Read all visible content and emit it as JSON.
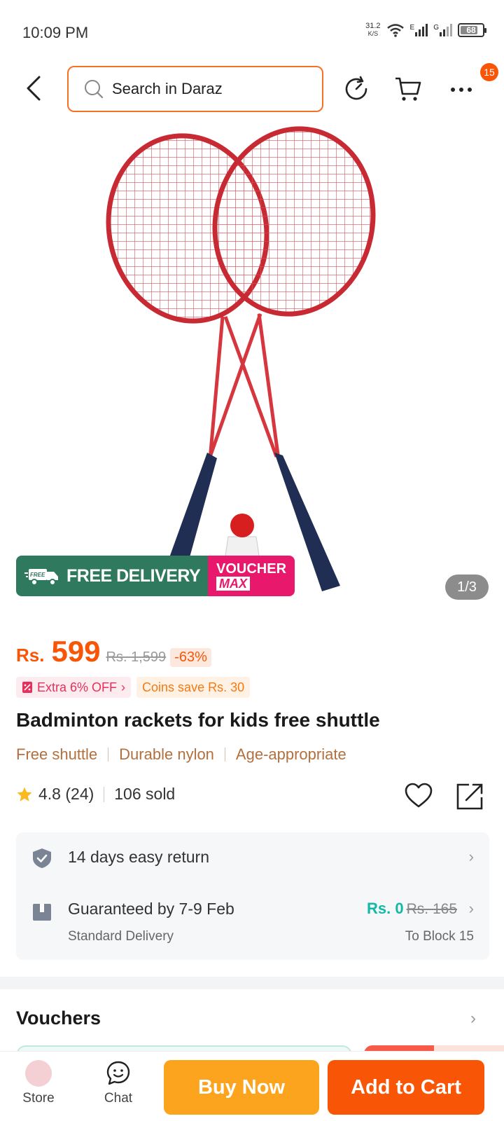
{
  "status_bar": {
    "time": "10:09 PM",
    "net_speed": "31.2",
    "net_unit": "K/S",
    "signal1": "E",
    "signal2": "G",
    "battery": "68"
  },
  "header": {
    "search_placeholder": "Search in Daraz",
    "more_badge": "15"
  },
  "hero": {
    "promo_free": "FREE DELIVERY",
    "promo_free_small": "FREE",
    "promo_voucher_top": "VOUCHER",
    "promo_voucher_bottom": "MAX",
    "image_counter": "1/3"
  },
  "product": {
    "currency": "Rs.",
    "price": "599",
    "old_price": "Rs. 1,599",
    "discount": "-63%",
    "extra_off": "Extra 6% OFF",
    "coins": "Coins save Rs. 30",
    "title": "Badminton rackets for kids free shuttle",
    "features": [
      "Free shuttle",
      "Durable nylon",
      "Age-appropriate"
    ],
    "rating": "4.8 (24)",
    "sold": "106 sold"
  },
  "service": {
    "returns": "14 days easy return",
    "delivery_guarantee": "Guaranteed by 7-9 Feb",
    "delivery_type": "Standard Delivery",
    "shipping_now": "Rs. 0",
    "shipping_was": "Rs. 165",
    "destination": "To Block 15"
  },
  "vouchers": {
    "title": "Vouchers"
  },
  "bottom_bar": {
    "store_label": "Store",
    "chat_label": "Chat",
    "buy_now": "Buy Now",
    "add_to_cart": "Add to Cart"
  },
  "colors": {
    "accent": "#f85606",
    "buy_now": "#fca41e",
    "free_delivery": "#2f7a5f",
    "voucher_max": "#e8186d"
  }
}
